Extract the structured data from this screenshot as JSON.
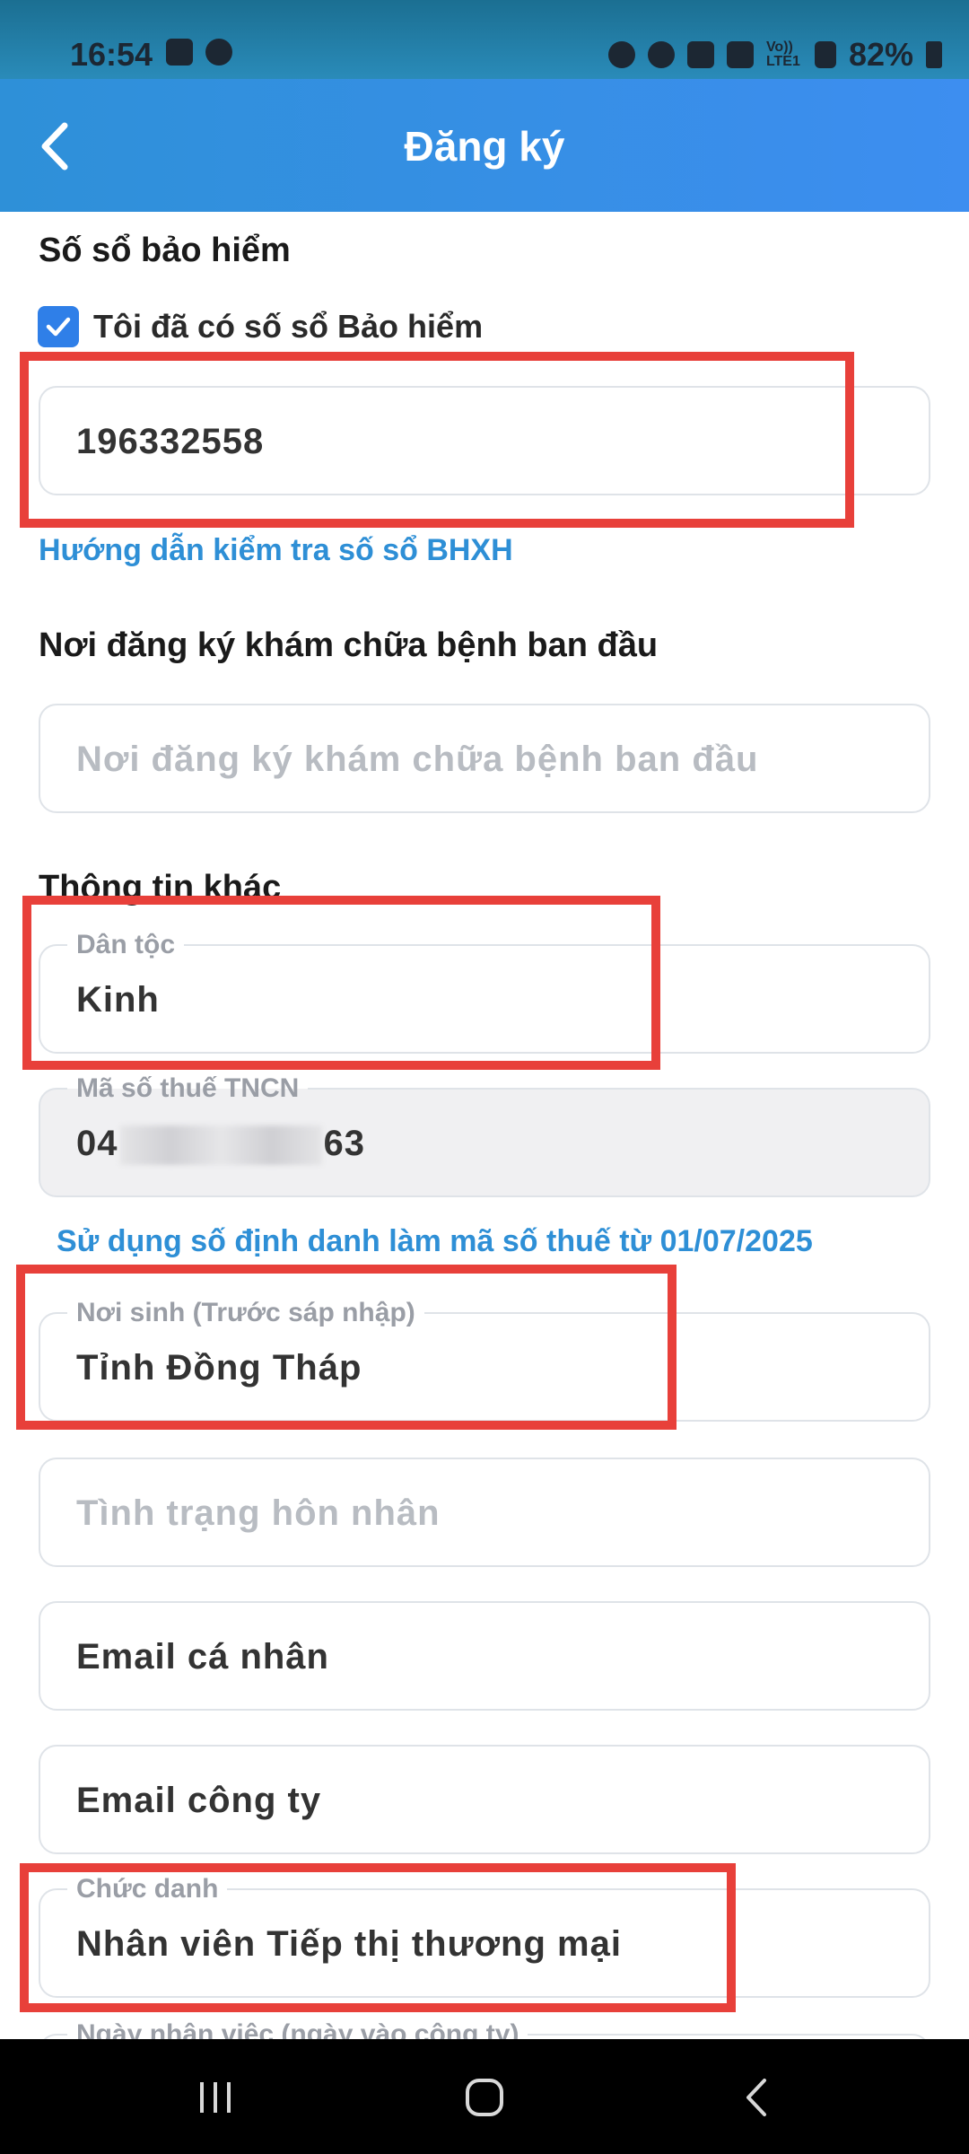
{
  "status_bar": {
    "time": "16:54",
    "network_label": "Vo)) LTE1",
    "battery": "82%"
  },
  "app_bar": {
    "title": "Đăng ký"
  },
  "insurance": {
    "section_title": "Số sổ bảo hiểm",
    "checkbox_label": "Tôi đã có số sổ Bảo hiểm",
    "checkbox_checked": true,
    "number_value": "196332558",
    "guide_link": "Hướng dẫn kiểm tra số sổ BHXH"
  },
  "clinic": {
    "section_title": "Nơi đăng ký khám chữa bệnh ban đầu",
    "placeholder": "Nơi đăng ký khám chữa bệnh ban đầu"
  },
  "other_info": {
    "section_title": "Thông tin khác",
    "ethnicity_label": "Dân tộc",
    "ethnicity_value": "Kinh",
    "tax_label": "Mã số thuế TNCN",
    "tax_prefix": "04",
    "tax_suffix": "63",
    "tax_note": "Sử dụng số định danh làm mã số thuế từ 01/07/2025",
    "birthplace_label": "Nơi sinh (Trước sáp nhập)",
    "birthplace_value": "Tỉnh Đồng Tháp",
    "marital_placeholder": "Tình trạng hôn nhân",
    "personal_email_placeholder": "Email cá nhân",
    "company_email_placeholder": "Email công ty",
    "job_title_label": "Chức danh",
    "job_title_value": "Nhân viên Tiếp thị thương mại",
    "start_date_label": "Ngày nhận việc (ngày vào công ty)"
  },
  "colors": {
    "accent": "#2e90d8",
    "link": "#2e8fd6",
    "highlight": "#e8403a"
  },
  "icons": [
    "back-arrow-icon",
    "checkmark-icon",
    "recent-apps-icon",
    "home-icon",
    "back-nav-icon"
  ]
}
